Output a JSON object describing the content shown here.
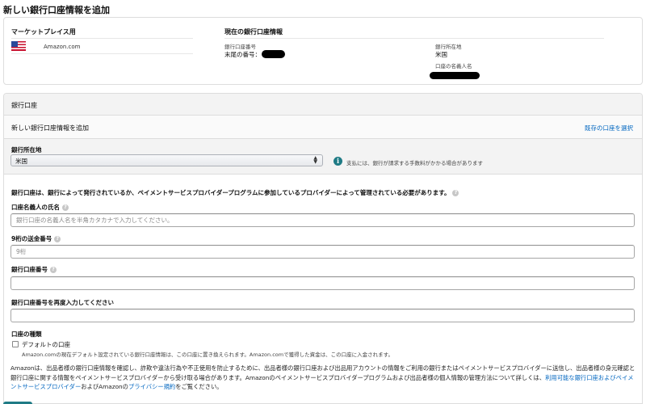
{
  "page": {
    "title": "新しい銀行口座情報を追加"
  },
  "summary": {
    "marketplace_heading": "マーケットプレイス用",
    "marketplace_value": "Amazon.com",
    "current_heading": "現在の銀行口座情報",
    "account_number_label": "銀行口座番号",
    "account_number_value": "末尾の番号：",
    "bank_location_label": "銀行所在地",
    "bank_location_value": "米国",
    "holder_name_label": "口座の名義人名"
  },
  "bank": {
    "section_title": "銀行口座",
    "add_title": "新しい銀行口座情報を追加",
    "select_existing_link": "既存の口座を選択",
    "location_label": "銀行所在地",
    "location_selected": "米国",
    "fee_info": "支払には、銀行が請求する手数料がかかる場合があります",
    "requirement_text": "銀行口座は、銀行によって発行されているか、ペイメントサービスプロバイダープログラムに参加しているプロバイダーによって管理されている必要があります。",
    "holder_name_label": "口座名義人の氏名",
    "holder_name_placeholder": "銀行口座の名義人名を半角カタカナで入力してください。",
    "routing_label": "9桁の送金番号",
    "routing_placeholder": "9桁",
    "account_label": "銀行口座番号",
    "account_value": "",
    "account_confirm_label": "銀行口座番号を再度入力してください",
    "account_confirm_value": "",
    "account_type_label": "口座の種類",
    "default_checkbox_label": "デフォルトの口座",
    "default_checkbox_note": "Amazon.comの現在デフォルト設定されている銀行口座情報は、この口座に置き換えられます。Amazon.comで獲得した資金は、この口座に入金されます。",
    "disclaimer_part1": "Amazonは、出品者様の銀行口座情報を確認し、詐欺や違法行為や不正使用を防止するために、出品者様の銀行口座および出品用アカウントの情報をご利用の銀行またはペイメントサービスプロバイダーに送信し、出品者様の身元確認と銀行口座に関する情報をペイメントサービスプロバイダーから受け取る場合があります。Amazonのペイメントサービスプロバイダープログラムおよび出品者様の個人情報の管理方法について詳しくは、",
    "disclaimer_link1": "利用可能な銀行口座およびペイメントサービスプロバイダー",
    "disclaimer_part2": "およびAmazonの",
    "disclaimer_link2": "プライバシー規約",
    "disclaimer_part3": "をご覧ください。"
  },
  "icons": {
    "info": "info-icon",
    "help": "help-icon",
    "flag": "us-flag-icon"
  },
  "colors": {
    "link": "#0066c0",
    "info": "#1f7b85",
    "section_bg": "#f3f3f3"
  }
}
